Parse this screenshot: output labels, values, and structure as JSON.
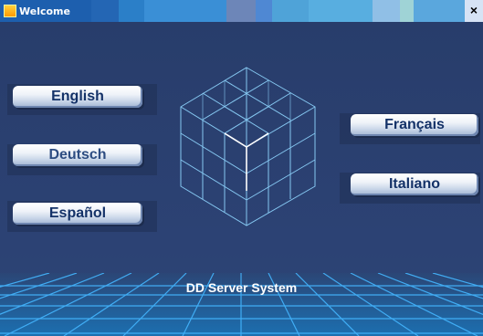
{
  "window": {
    "title": "Welcome",
    "close_symbol": "×",
    "icon": "app-icon"
  },
  "languages": {
    "english": "English",
    "deutsch": "Deutsch",
    "espanol": "Español",
    "francais": "Français",
    "italiano": "Italiano"
  },
  "product": {
    "name": "DD Server System"
  },
  "colors": {
    "background": "#2b4170",
    "titlebar": "#1d5fae",
    "button_text": "#143268",
    "cube_lines": "#8fd6ff"
  }
}
